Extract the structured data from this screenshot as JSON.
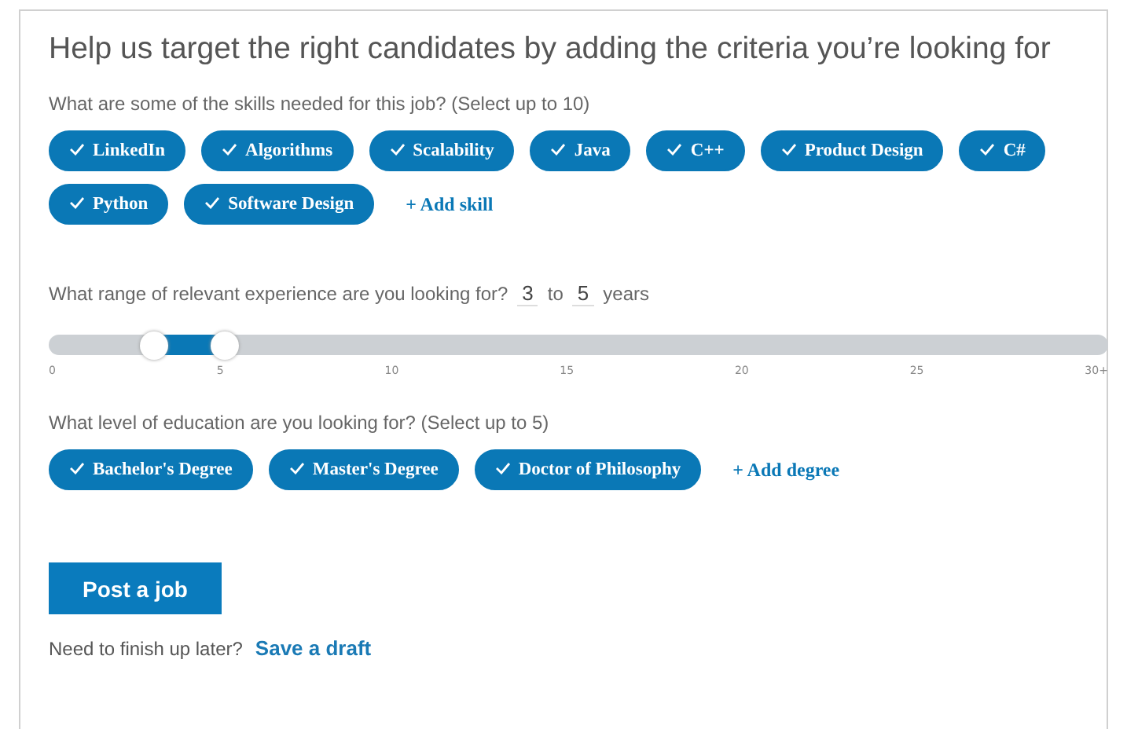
{
  "title": "Help us target the right candidates by adding the criteria you’re looking for",
  "skills": {
    "question": "What are some of the skills needed for this job? (Select up to 10)",
    "items": [
      {
        "label": "LinkedIn",
        "selected": true
      },
      {
        "label": "Algorithms",
        "selected": true
      },
      {
        "label": "Scalability",
        "selected": true
      },
      {
        "label": "Java",
        "selected": true
      },
      {
        "label": "C++",
        "selected": true
      },
      {
        "label": "Product Design",
        "selected": true
      },
      {
        "label": "C#",
        "selected": true
      },
      {
        "label": "Python",
        "selected": true
      },
      {
        "label": "Software Design",
        "selected": true
      }
    ],
    "add": "+ Add skill"
  },
  "experience": {
    "question": "What range of relevant experience are you looking for?",
    "from": "3",
    "to_word": "to",
    "to": "5",
    "unit": "years",
    "low": {
      "level": 0.1
    },
    "high": {
      "level": 0.1667
    },
    "ticks": [
      "0",
      "5",
      "10",
      "15",
      "20",
      "25",
      "30+"
    ]
  },
  "education": {
    "question": "What level of education are you looking for? (Select up to 5)",
    "items": [
      {
        "label": "Bachelor's Degree",
        "selected": true
      },
      {
        "label": "Master's Degree",
        "selected": true
      },
      {
        "label": "Doctor of Philosophy",
        "selected": true
      }
    ],
    "add": "+ Add degree"
  },
  "post_button": "Post a job",
  "draft": {
    "prompt": "Need to finish up later?",
    "link": "Save a draft"
  }
}
